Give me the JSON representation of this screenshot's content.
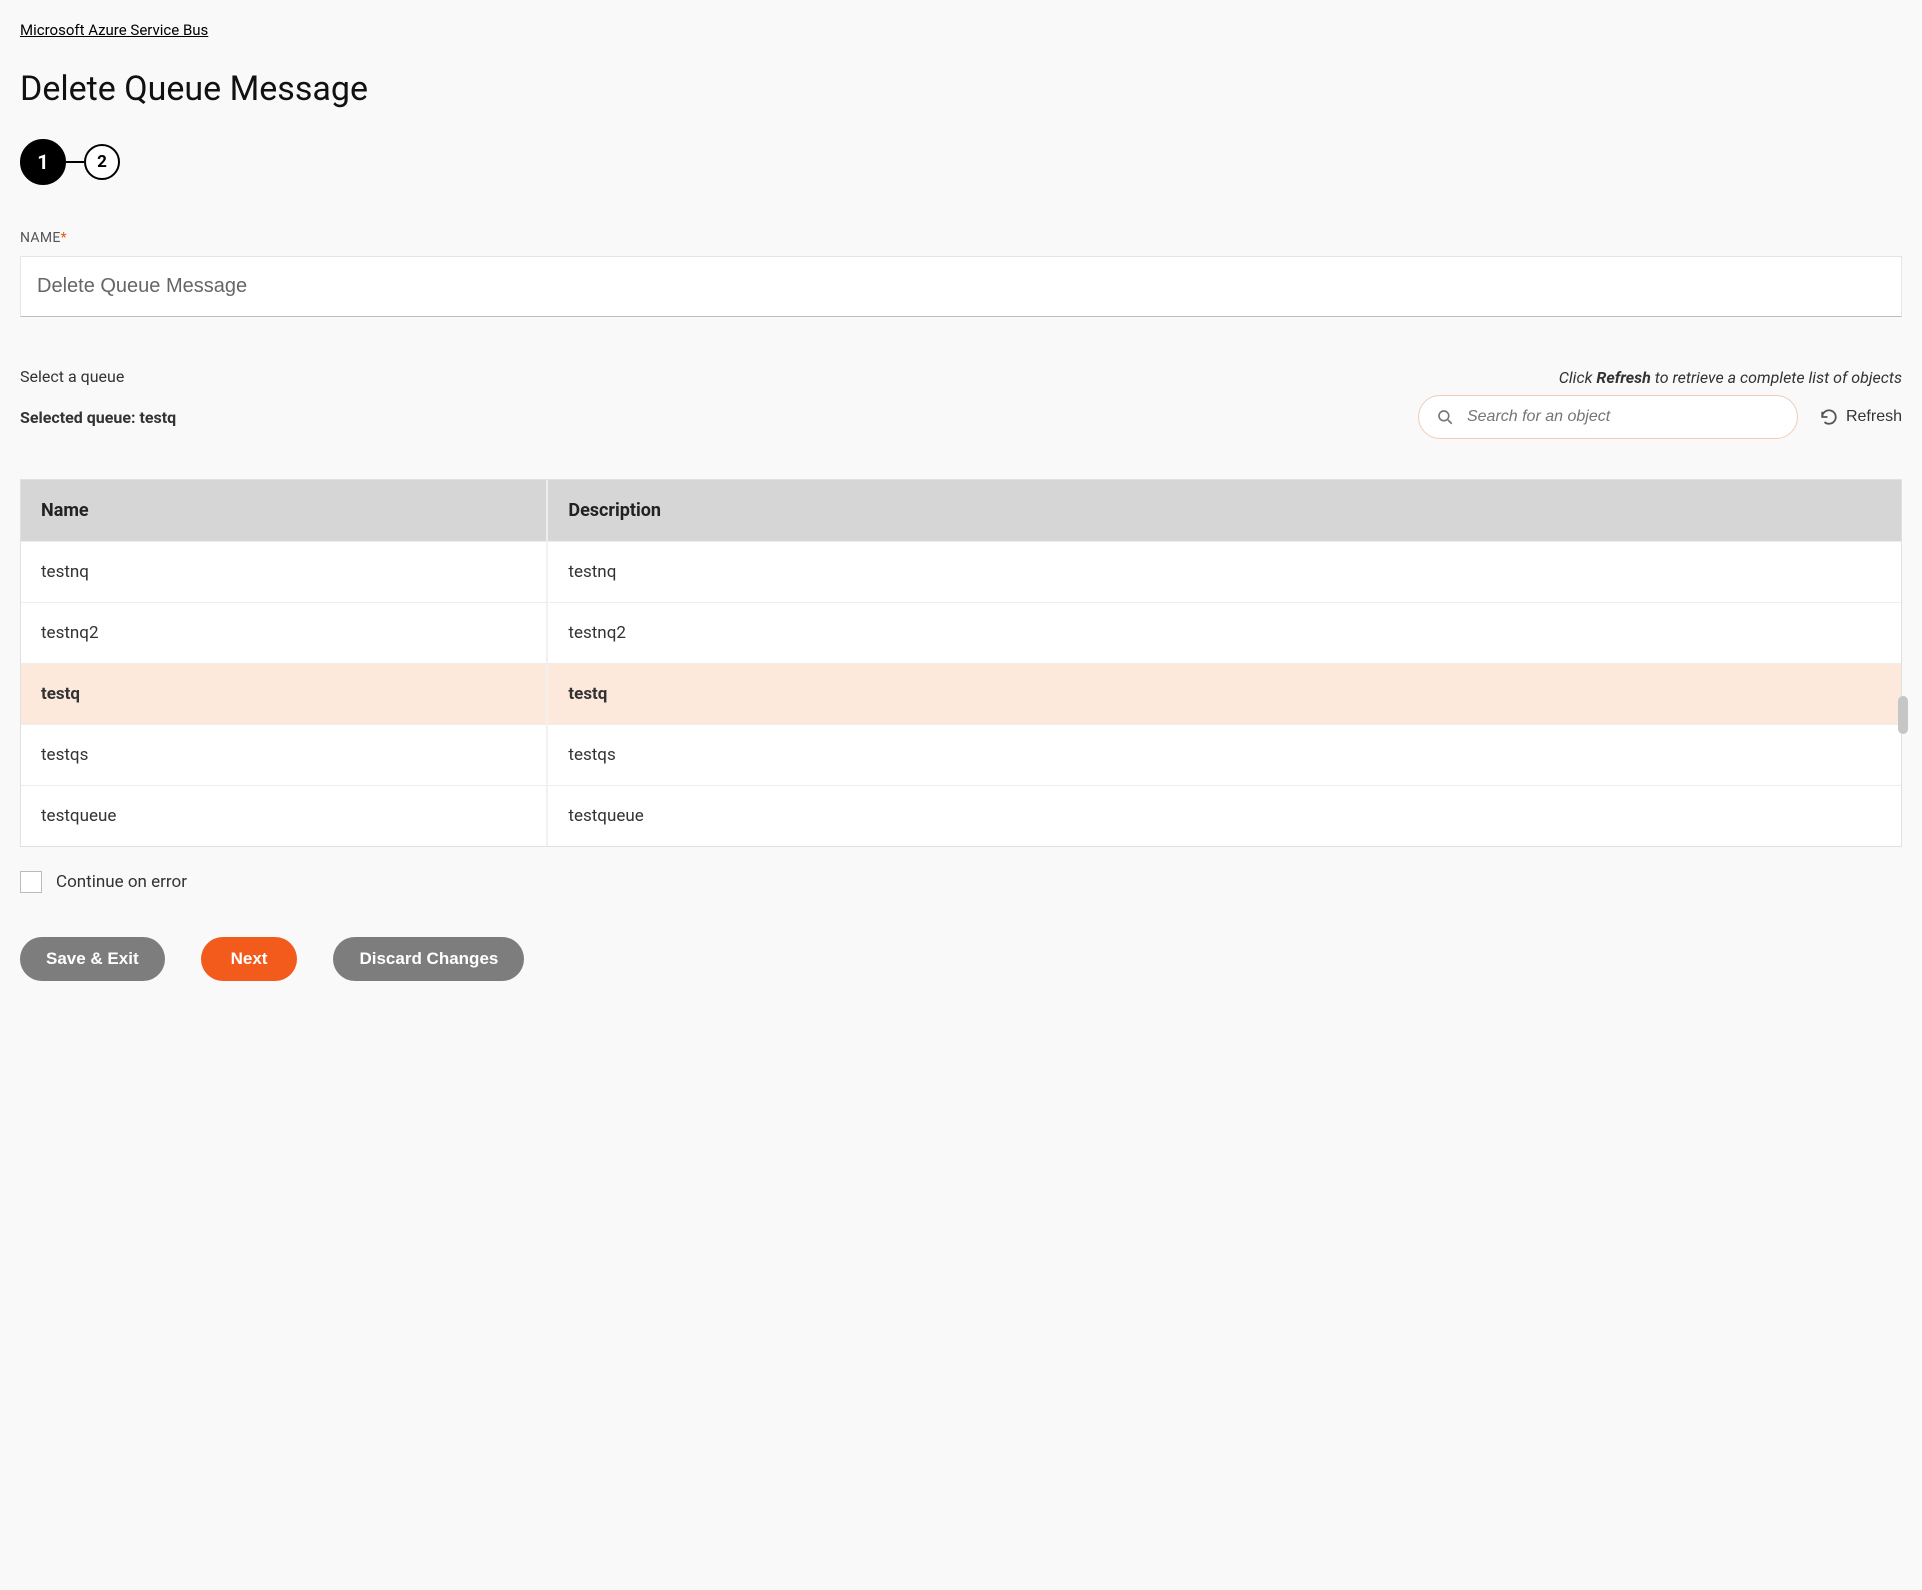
{
  "breadcrumb": "Microsoft Azure Service Bus",
  "title": "Delete Queue Message",
  "stepper": {
    "steps": [
      "1",
      "2"
    ],
    "active": 0
  },
  "nameField": {
    "label": "NAME",
    "value": "Delete Queue Message"
  },
  "selectLabel": "Select a queue",
  "hint": {
    "prefix": "Click ",
    "bold": "Refresh",
    "suffix": " to retrieve a complete list of objects"
  },
  "selectedLabel": "Selected queue: testq",
  "search": {
    "placeholder": "Search for an object"
  },
  "refreshLabel": "Refresh",
  "table": {
    "headers": {
      "name": "Name",
      "description": "Description"
    },
    "rows": [
      {
        "name": "testnq",
        "description": "testnq",
        "selected": false
      },
      {
        "name": "testnq2",
        "description": "testnq2",
        "selected": false
      },
      {
        "name": "testq",
        "description": "testq",
        "selected": true
      },
      {
        "name": "testqs",
        "description": "testqs",
        "selected": false
      },
      {
        "name": "testqueue",
        "description": "testqueue",
        "selected": false
      }
    ]
  },
  "continueLabel": "Continue on error",
  "buttons": {
    "save": "Save & Exit",
    "next": "Next",
    "discard": "Discard Changes"
  }
}
